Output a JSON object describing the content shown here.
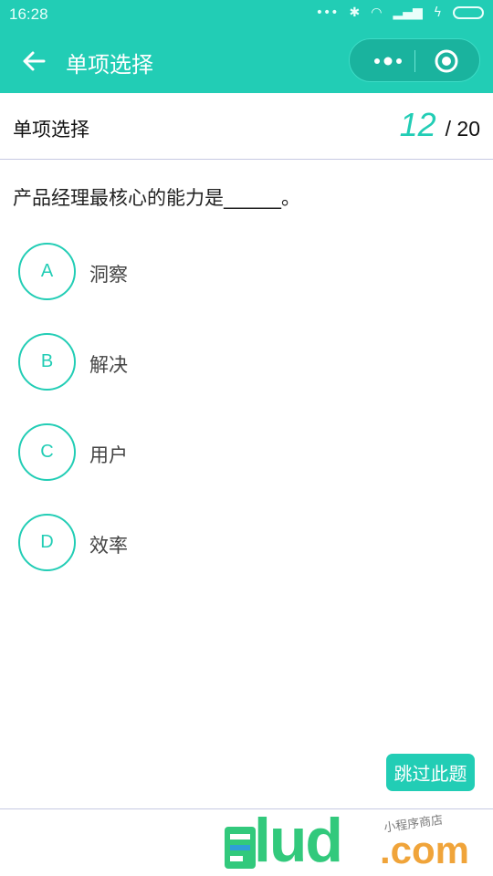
{
  "status_bar": {
    "time": "16:28"
  },
  "nav": {
    "title": "单项选择",
    "back_icon": "arrow-left-icon",
    "more_icon": "more-dots-icon",
    "close_icon": "target-close-icon"
  },
  "header": {
    "section_title": "单项选择",
    "current": "12",
    "total": "/ 20"
  },
  "question": {
    "text": "产品经理最核心的能力是______。"
  },
  "options": [
    {
      "key": "A",
      "label": "洞察"
    },
    {
      "key": "B",
      "label": "解决"
    },
    {
      "key": "C",
      "label": "用户"
    },
    {
      "key": "D",
      "label": "效率"
    }
  ],
  "skip_button": {
    "label": "跳过此题"
  },
  "watermark": {
    "brand": "lud",
    "domain": ".com",
    "subtitle": "小程序商店"
  },
  "colors": {
    "accent": "#22cdb5",
    "divider": "#c6c9e2"
  }
}
